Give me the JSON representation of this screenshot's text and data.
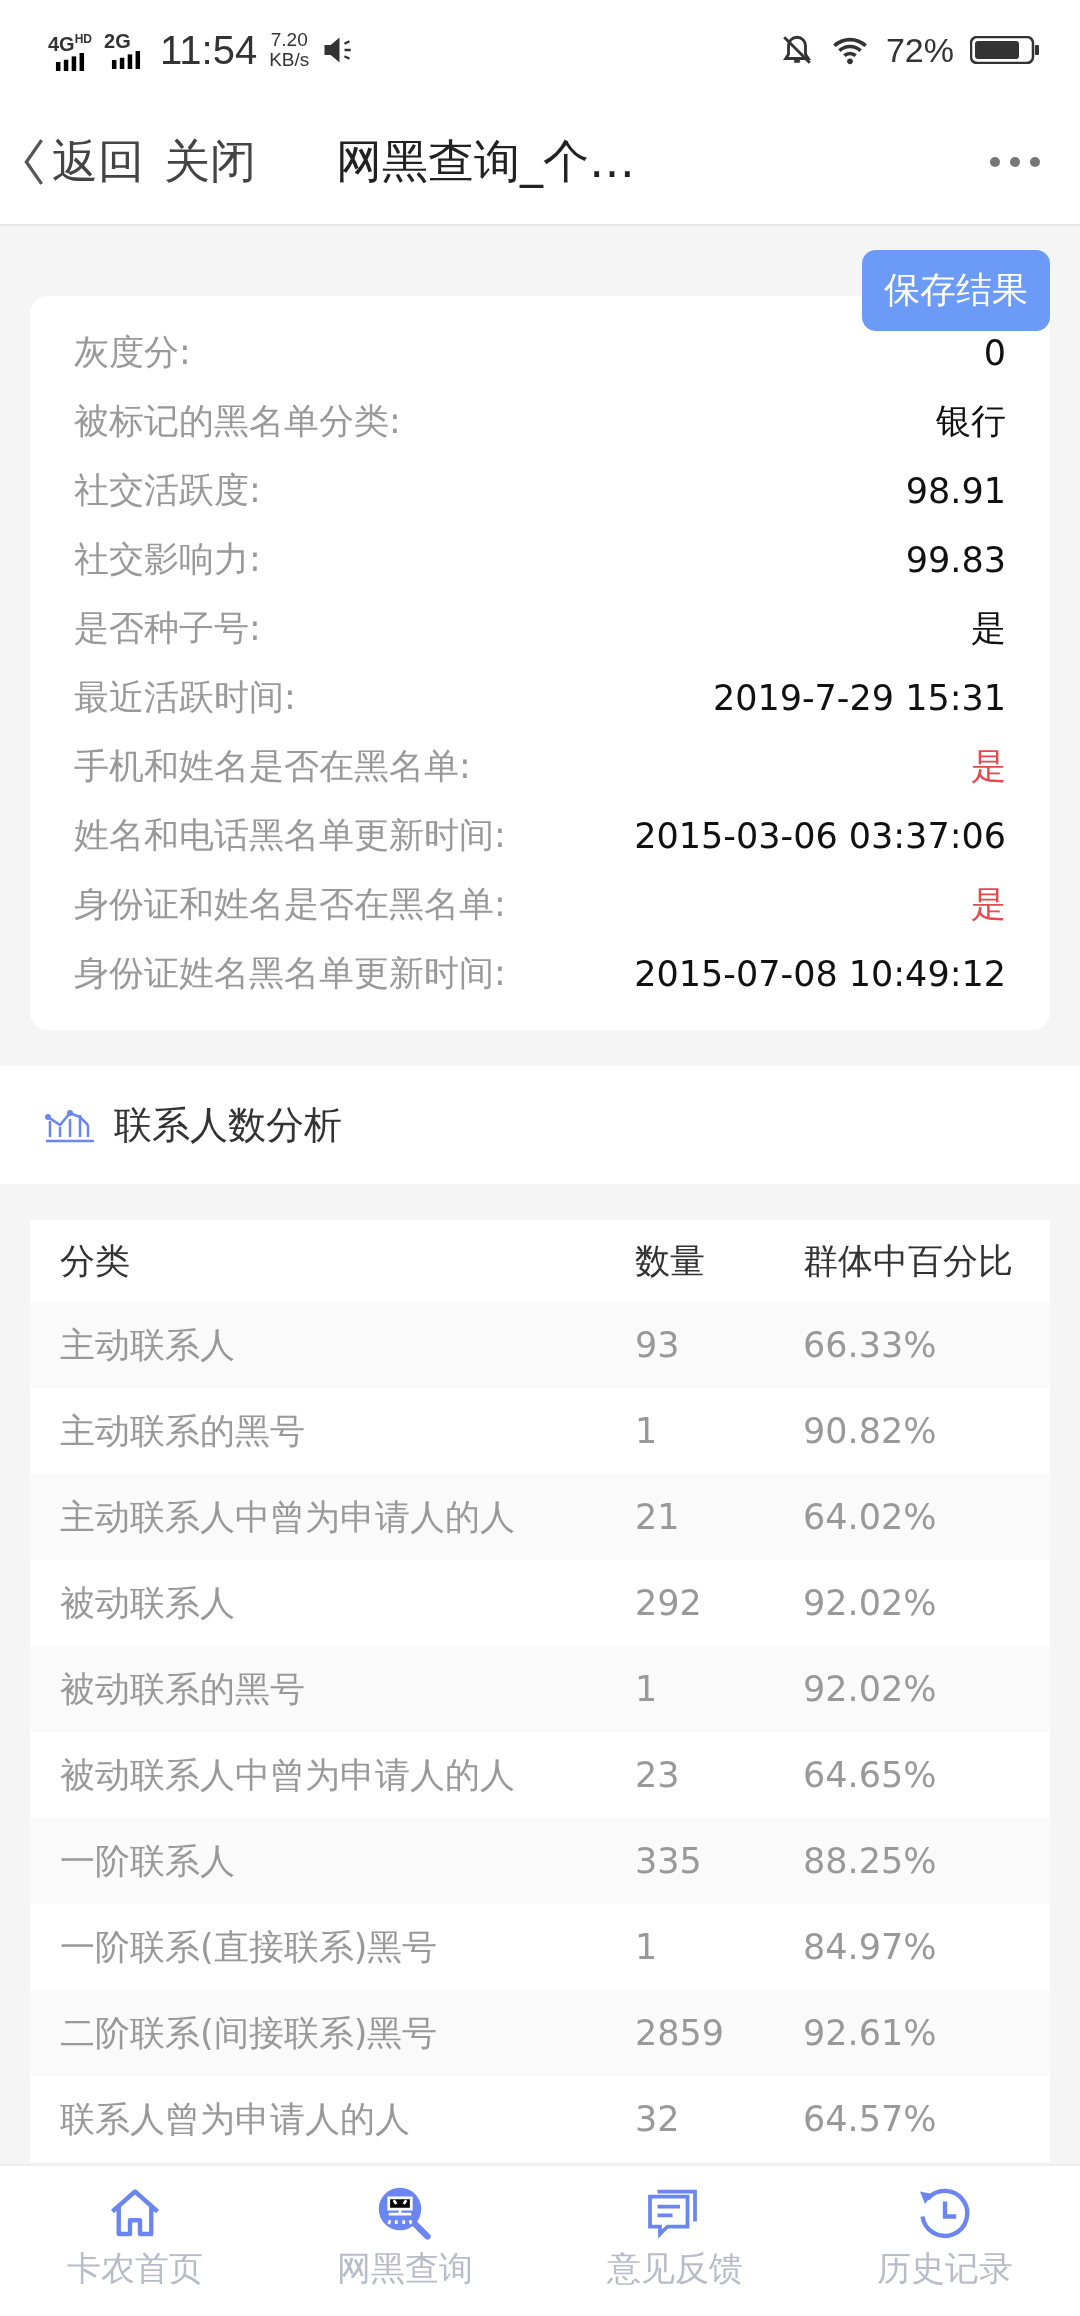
{
  "status_bar": {
    "network_1": "4G",
    "network_1_badge": "HD",
    "network_2": "2G",
    "time": "11:54",
    "speed": "7.20",
    "speed_unit": "KB/s",
    "battery": "72%"
  },
  "header": {
    "back": "返回",
    "close": "关闭",
    "title": "网黑查询_个…"
  },
  "save_button": "保存结果",
  "summary": [
    {
      "label": "灰度分:",
      "value": "0",
      "alert": false
    },
    {
      "label": "被标记的黑名单分类:",
      "value": "银行",
      "alert": false
    },
    {
      "label": "社交活跃度:",
      "value": "98.91",
      "alert": false
    },
    {
      "label": "社交影响力:",
      "value": "99.83",
      "alert": false
    },
    {
      "label": "是否种子号:",
      "value": "是",
      "alert": false
    },
    {
      "label": "最近活跃时间:",
      "value": "2019-7-29 15:31",
      "alert": false
    },
    {
      "label": "手机和姓名是否在黑名单:",
      "value": "是",
      "alert": true
    },
    {
      "label": "姓名和电话黑名单更新时间:",
      "value": "2015-03-06 03:37:06",
      "alert": false
    },
    {
      "label": "身份证和姓名是否在黑名单:",
      "value": "是",
      "alert": true
    },
    {
      "label": "身份证姓名黑名单更新时间:",
      "value": "2015-07-08 10:49:12",
      "alert": false
    }
  ],
  "section": {
    "title": "联系人数分析"
  },
  "table": {
    "columns": [
      "分类",
      "数量",
      "群体中百分比"
    ],
    "rows": [
      [
        "主动联系人",
        "93",
        "66.33%"
      ],
      [
        "主动联系的黑号",
        "1",
        "90.82%"
      ],
      [
        "主动联系人中曾为申请人的人",
        "21",
        "64.02%"
      ],
      [
        "被动联系人",
        "292",
        "92.02%"
      ],
      [
        "被动联系的黑号",
        "1",
        "92.02%"
      ],
      [
        "被动联系人中曾为申请人的人",
        "23",
        "64.65%"
      ],
      [
        "一阶联系人",
        "335",
        "88.25%"
      ],
      [
        "一阶联系(直接联系)黑号",
        "1",
        "84.97%"
      ],
      [
        "二阶联系(间接联系)黑号",
        "2859",
        "92.61%"
      ],
      [
        "联系人曾为申请人的人",
        "32",
        "64.57%"
      ]
    ]
  },
  "bottom_nav": [
    {
      "label": "卡农首页",
      "kind": "home"
    },
    {
      "label": "网黑查询",
      "kind": "search"
    },
    {
      "label": "意见反馈",
      "kind": "feedback"
    },
    {
      "label": "历史记录",
      "kind": "history"
    }
  ]
}
